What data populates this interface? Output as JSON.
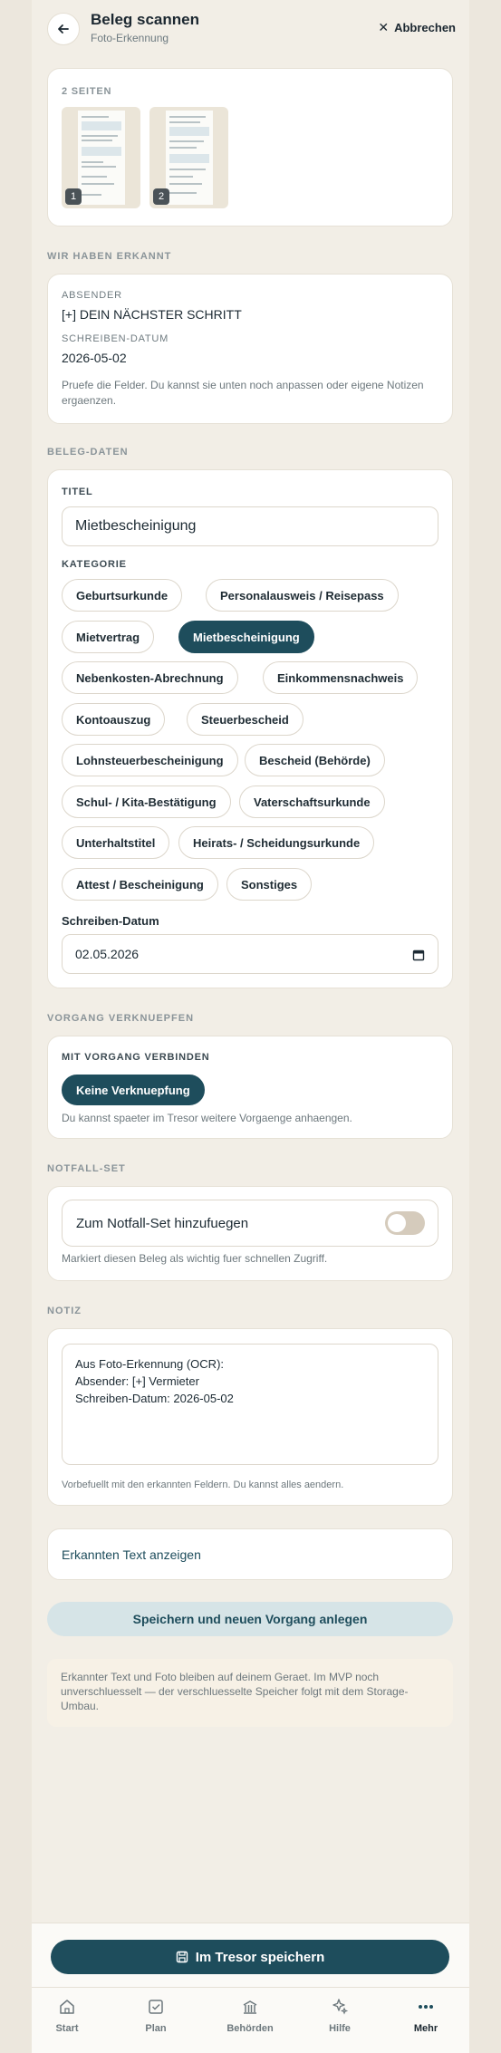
{
  "header": {
    "title": "Beleg scannen",
    "subtitle": "Foto-Erkennung",
    "cancel_label": "Abbrechen"
  },
  "pages": {
    "label": "2 SEITEN",
    "thumbs": [
      "1",
      "2"
    ]
  },
  "recognized": {
    "section_label": "WIR HABEN ERKANNT",
    "sender_label": "ABSENDER",
    "sender_value": "[+] DEIN NÄCHSTER SCHRITT",
    "date_label": "SCHREIBEN-DATUM",
    "date_value": "2026-05-02",
    "hint": "Pruefe die Felder. Du kannst sie unten noch anpassen oder eigene Notizen ergaenzen."
  },
  "beleg": {
    "section_label": "BELEG-DATEN",
    "title_label": "TITEL",
    "title_value": "Mietbescheinigung",
    "category_label": "KATEGORIE",
    "categories": [
      "Geburtsurkunde",
      "Personalausweis / Reisepass",
      "Mietvertrag",
      "Mietbescheinigung",
      "Nebenkosten-Abrechnung",
      "Einkommensnachweis",
      "Kontoauszug",
      "Steuerbescheid",
      "Lohnsteuerbescheinigung",
      "Bescheid (Behörde)",
      "Schul- / Kita-Bestätigung",
      "Vaterschaftsurkunde",
      "Unterhaltstitel",
      "Heirats- / Scheidungsurkunde",
      "Attest / Bescheinigung",
      "Sonstiges"
    ],
    "selected_category": "Mietbescheinigung",
    "date_label": "Schreiben-Datum",
    "date_value": "02.05.2026"
  },
  "vorgang": {
    "section_label": "VORGANG VERKNUEPFEN",
    "link_label": "MIT VORGANG VERBINDEN",
    "button_label": "Keine Verknuepfung",
    "hint": "Du kannst spaeter im Tresor weitere Vorgaenge anhaengen."
  },
  "notfall": {
    "section_label": "NOTFALL-SET",
    "toggle_label": "Zum Notfall-Set hinzufuegen",
    "toggle_on": false,
    "hint": "Markiert diesen Beleg als wichtig fuer schnellen Zugriff."
  },
  "notiz": {
    "section_label": "NOTIZ",
    "value": "Aus Foto-Erkennung (OCR):\nAbsender: [+] Vermieter\nSchreiben-Datum: 2026-05-02",
    "hint": "Vorbefuellt mit den erkannten Feldern. Du kannst alles aendern."
  },
  "show_text_label": "Erkannten Text anzeigen",
  "save_new_label": "Speichern und neuen Vorgang anlegen",
  "info_text": "Erkannter Text und Foto bleiben auf deinem Geraet. Im MVP noch unverschluesselt — der verschluesselte Speicher folgt mit dem Storage-Umbau.",
  "primary_button_label": "Im Tresor speichern",
  "nav": {
    "items": [
      {
        "label": "Start",
        "icon": "home-icon"
      },
      {
        "label": "Plan",
        "icon": "checklist-icon"
      },
      {
        "label": "Behörden",
        "icon": "building-icon"
      },
      {
        "label": "Hilfe",
        "icon": "sparkle-icon"
      },
      {
        "label": "Mehr",
        "icon": "more-icon",
        "active": true
      }
    ]
  },
  "colors": {
    "accent": "#1e4d5c",
    "background": "#f2eee6",
    "card": "#ffffff",
    "secondary_button": "#d6e4e7"
  }
}
